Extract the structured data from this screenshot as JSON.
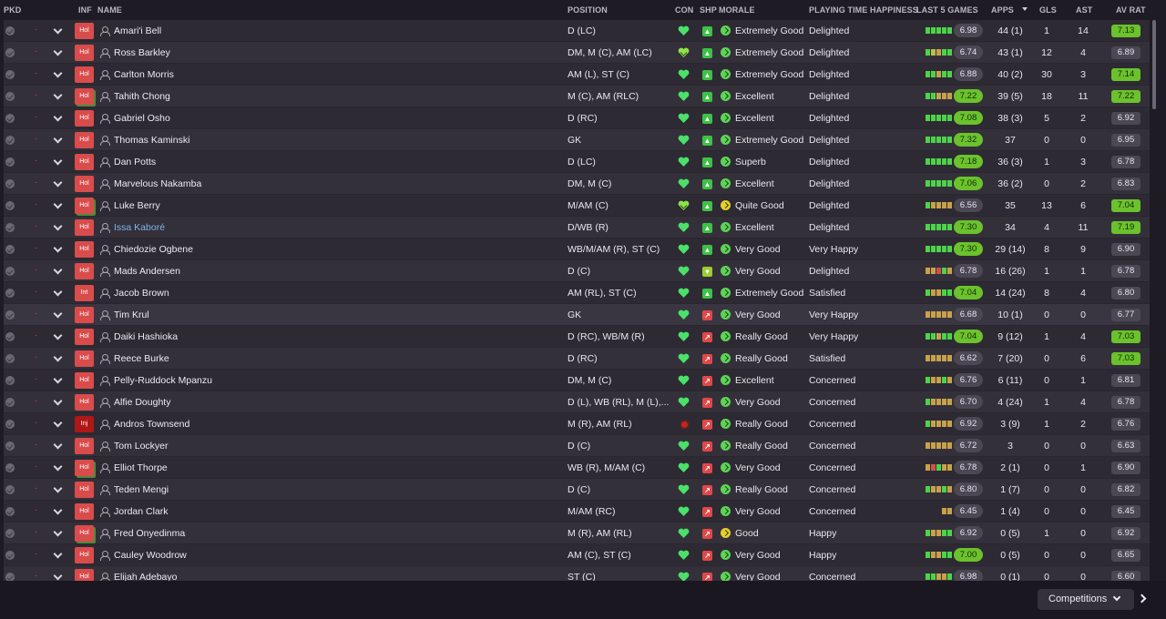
{
  "columns": {
    "pkd": "PKD",
    "inf": "INF",
    "name": "NAME",
    "position": "POSITION",
    "con": "CON",
    "shp": "SHP",
    "morale": "MORALE",
    "pth": "PLAYING TIME HAPPINESS",
    "last5": "LAST 5 GAMES",
    "apps": "APPS",
    "gls": "GLS",
    "ast": "AST",
    "avrat": "AV RAT"
  },
  "colors": {
    "good": "#4dd34a",
    "bad": "#d05151",
    "rating_high": "#6bc22c",
    "injury": "#b01717"
  },
  "players": [
    {
      "inf": "Hol",
      "name": "Amari'i Bell",
      "position": "D (LC)",
      "con": "heart",
      "shp": "g",
      "morale": "Extremely Good",
      "morale_c": "g",
      "pth": "Delighted",
      "form": [
        "g",
        "g",
        "g",
        "g",
        "g"
      ],
      "avg": "6.98",
      "avg_hi": false,
      "apps": "44 (1)",
      "gls": "1",
      "ast": "14",
      "avr": "7.13",
      "avr_hi": true
    },
    {
      "inf": "Hol",
      "name": "Ross Barkley",
      "position": "DM, M (C), AM (LC)",
      "con": "heart-y",
      "shp": "g",
      "morale": "Extremely Good",
      "morale_c": "g",
      "pth": "Delighted",
      "form": [
        "g",
        "y",
        "o",
        "g",
        "g"
      ],
      "avg": "6.74",
      "avg_hi": false,
      "apps": "43 (1)",
      "gls": "12",
      "ast": "4",
      "avr": "6.89",
      "avr_hi": false
    },
    {
      "inf": "Hol",
      "name": "Carlton Morris",
      "position": "AM (L), ST (C)",
      "con": "heart",
      "shp": "g",
      "morale": "Extremely Good",
      "morale_c": "g",
      "pth": "Delighted",
      "form": [
        "g",
        "g",
        "o",
        "g",
        "g"
      ],
      "avg": "6.88",
      "avg_hi": false,
      "apps": "40 (2)",
      "gls": "30",
      "ast": "3",
      "avr": "7.14",
      "avr_hi": true
    },
    {
      "inf": "Hol",
      "name": "Tahith Chong",
      "position": "M (C), AM (RLC)",
      "con": "heart",
      "shp": "g",
      "morale": "Excellent",
      "morale_c": "g",
      "pth": "Delighted",
      "form": [
        "g",
        "g",
        "o",
        "o",
        "o"
      ],
      "avg": "7.22",
      "avg_hi": true,
      "apps": "39 (5)",
      "gls": "18",
      "ast": "11",
      "avr": "7.22",
      "avr_hi": true,
      "grn": true
    },
    {
      "inf": "Hol",
      "name": "Gabriel Osho",
      "position": "D (RC)",
      "con": "heart",
      "shp": "g",
      "morale": "Excellent",
      "morale_c": "g",
      "pth": "Delighted",
      "form": [
        "g",
        "g",
        "g",
        "g",
        "g"
      ],
      "avg": "7.08",
      "avg_hi": true,
      "apps": "38 (3)",
      "gls": "5",
      "ast": "2",
      "avr": "6.92",
      "avr_hi": false
    },
    {
      "inf": "Hol",
      "name": "Thomas Kaminski",
      "position": "GK",
      "con": "heart",
      "shp": "g",
      "morale": "Extremely Good",
      "morale_c": "g",
      "pth": "Delighted",
      "form": [
        "g",
        "g",
        "g",
        "g",
        "g"
      ],
      "avg": "7.32",
      "avg_hi": true,
      "apps": "37",
      "gls": "0",
      "ast": "0",
      "avr": "6.95",
      "avr_hi": false
    },
    {
      "inf": "Hol",
      "name": "Dan Potts",
      "position": "D (LC)",
      "con": "heart",
      "shp": "g",
      "morale": "Superb",
      "morale_c": "g",
      "pth": "Delighted",
      "form": [
        "g",
        "g",
        "g",
        "g",
        "g"
      ],
      "avg": "7.18",
      "avg_hi": true,
      "apps": "36 (3)",
      "gls": "1",
      "ast": "3",
      "avr": "6.78",
      "avr_hi": false
    },
    {
      "inf": "Hol",
      "name": "Marvelous Nakamba",
      "position": "DM, M (C)",
      "con": "heart",
      "shp": "g",
      "morale": "Excellent",
      "morale_c": "g",
      "pth": "Delighted",
      "form": [
        "g",
        "g",
        "g",
        "g",
        "g"
      ],
      "avg": "7.06",
      "avg_hi": true,
      "apps": "36 (2)",
      "gls": "0",
      "ast": "2",
      "avr": "6.83",
      "avr_hi": false
    },
    {
      "inf": "Hol",
      "name": "Luke Berry",
      "position": "M/AM (C)",
      "con": "heart-y",
      "shp": "g",
      "morale": "Quite Good",
      "morale_c": "y",
      "pth": "Delighted",
      "form": [
        "g",
        "o",
        "o",
        "o",
        "o"
      ],
      "avg": "6.56",
      "avg_hi": false,
      "apps": "35",
      "gls": "13",
      "ast": "6",
      "avr": "7.04",
      "avr_hi": true,
      "grn": true
    },
    {
      "inf": "Hol",
      "name": "Issa Kaboré",
      "position": "D/WB (R)",
      "con": "heart",
      "shp": "g",
      "morale": "Excellent",
      "morale_c": "g",
      "pth": "Delighted",
      "form": [
        "g",
        "g",
        "g",
        "g",
        "g"
      ],
      "avg": "7.30",
      "avg_hi": true,
      "apps": "34",
      "gls": "4",
      "ast": "11",
      "avr": "7.19",
      "avr_hi": true,
      "link": true
    },
    {
      "inf": "Hol",
      "name": "Chiedozie Ogbene",
      "position": "WB/M/AM (R), ST (C)",
      "con": "heart",
      "shp": "g",
      "morale": "Very Good",
      "morale_c": "g",
      "pth": "Very Happy",
      "form": [
        "g",
        "g",
        "g",
        "g",
        "g"
      ],
      "avg": "7.30",
      "avg_hi": true,
      "apps": "29 (14)",
      "gls": "8",
      "ast": "9",
      "avr": "6.90",
      "avr_hi": false
    },
    {
      "inf": "Hol",
      "name": "Mads Andersen",
      "position": "D (C)",
      "con": "heart",
      "shp": "y",
      "morale": "Very Good",
      "morale_c": "g",
      "pth": "Delighted",
      "form": [
        "o",
        "o",
        "r",
        "g",
        "o"
      ],
      "avg": "6.78",
      "avg_hi": false,
      "apps": "16 (26)",
      "gls": "1",
      "ast": "1",
      "avr": "6.78",
      "avr_hi": false
    },
    {
      "inf": "Int",
      "name": "Jacob Brown",
      "position": "AM (RL), ST (C)",
      "con": "heart",
      "shp": "g",
      "morale": "Extremely Good",
      "morale_c": "g",
      "pth": "Satisfied",
      "form": [
        "g",
        "o",
        "o",
        "g",
        "g"
      ],
      "avg": "7.04",
      "avg_hi": true,
      "apps": "14 (24)",
      "gls": "8",
      "ast": "4",
      "avr": "6.80",
      "avr_hi": false
    },
    {
      "inf": "Hol",
      "name": "Tim Krul",
      "position": "GK",
      "con": "heart",
      "shp": "r",
      "morale": "Very Good",
      "morale_c": "g",
      "pth": "Very Happy",
      "form": [
        "o",
        "o",
        "o",
        "o",
        "o"
      ],
      "avg": "6.68",
      "avg_hi": false,
      "apps": "10 (1)",
      "gls": "0",
      "ast": "0",
      "avr": "6.77",
      "avr_hi": false
    },
    {
      "inf": "Hol",
      "name": "Daiki Hashioka",
      "position": "D (RC), WB/M (R)",
      "con": "heart",
      "shp": "r",
      "morale": "Really Good",
      "morale_c": "g",
      "pth": "Very Happy",
      "form": [
        "g",
        "g",
        "o",
        "g",
        "g"
      ],
      "avg": "7.04",
      "avg_hi": true,
      "apps": "9 (12)",
      "gls": "1",
      "ast": "4",
      "avr": "7.03",
      "avr_hi": true
    },
    {
      "inf": "Hol",
      "name": "Reece Burke",
      "position": "D (RC)",
      "con": "heart",
      "shp": "r",
      "morale": "Really Good",
      "morale_c": "g",
      "pth": "Satisfied",
      "form": [
        "o",
        "o",
        "o",
        "o",
        "o"
      ],
      "avg": "6.62",
      "avg_hi": false,
      "apps": "7 (20)",
      "gls": "0",
      "ast": "6",
      "avr": "7.03",
      "avr_hi": true
    },
    {
      "inf": "Hol",
      "name": "Pelly-Ruddock Mpanzu",
      "position": "DM, M (C)",
      "con": "heart",
      "shp": "r",
      "morale": "Excellent",
      "morale_c": "g",
      "pth": "Concerned",
      "form": [
        "g",
        "o",
        "o",
        "g",
        "o"
      ],
      "avg": "6.76",
      "avg_hi": false,
      "apps": "6 (11)",
      "gls": "0",
      "ast": "1",
      "avr": "6.81",
      "avr_hi": false
    },
    {
      "inf": "Hol",
      "name": "Alfie Doughty",
      "position": "D (L), WB (RL), M (L),...",
      "con": "heart",
      "shp": "r",
      "morale": "Very Good",
      "morale_c": "g",
      "pth": "Concerned",
      "form": [
        "g",
        "o",
        "o",
        "o",
        "o"
      ],
      "avg": "6.70",
      "avg_hi": false,
      "apps": "4 (24)",
      "gls": "1",
      "ast": "4",
      "avr": "6.78",
      "avr_hi": false
    },
    {
      "inf": "Inj",
      "name": "Andros Townsend",
      "position": "M (R), AM (RL)",
      "con": "injury",
      "shp": "r",
      "morale": "Really Good",
      "morale_c": "g",
      "pth": "Concerned",
      "form": [
        "g",
        "o",
        "o",
        "o",
        "o"
      ],
      "avg": "6.92",
      "avg_hi": false,
      "apps": "3 (9)",
      "gls": "1",
      "ast": "2",
      "avr": "6.76",
      "avr_hi": false
    },
    {
      "inf": "Hol",
      "name": "Tom Lockyer",
      "position": "D (C)",
      "con": "heart",
      "shp": "r",
      "morale": "Really Good",
      "morale_c": "g",
      "pth": "Concerned",
      "form": [
        "o",
        "o",
        "o",
        "o",
        "o"
      ],
      "avg": "6.72",
      "avg_hi": false,
      "apps": "3",
      "gls": "0",
      "ast": "0",
      "avr": "6.63",
      "avr_hi": false
    },
    {
      "inf": "Hol",
      "name": "Elliot Thorpe",
      "position": "WB (R), M/AM (C)",
      "con": "heart",
      "shp": "r",
      "morale": "Very Good",
      "morale_c": "g",
      "pth": "Concerned",
      "form": [
        "o",
        "r",
        "g",
        "o",
        "o"
      ],
      "avg": "6.78",
      "avg_hi": false,
      "apps": "2 (1)",
      "gls": "0",
      "ast": "1",
      "avr": "6.90",
      "avr_hi": false,
      "grn": true
    },
    {
      "inf": "Hol",
      "name": "Teden Mengi",
      "position": "D (C)",
      "con": "heart",
      "shp": "r",
      "morale": "Really Good",
      "morale_c": "g",
      "pth": "Concerned",
      "form": [
        "g",
        "o",
        "o",
        "g",
        "o"
      ],
      "avg": "6.80",
      "avg_hi": false,
      "apps": "1 (7)",
      "gls": "0",
      "ast": "0",
      "avr": "6.82",
      "avr_hi": false
    },
    {
      "inf": "Hol",
      "name": "Jordan Clark",
      "position": "M/AM (RC)",
      "con": "heart",
      "shp": "r",
      "morale": "Very Good",
      "morale_c": "g",
      "pth": "Concerned",
      "form": [
        "o",
        "o"
      ],
      "avg": "6.45",
      "avg_hi": false,
      "apps": "1 (4)",
      "gls": "0",
      "ast": "0",
      "avr": "6.45",
      "avr_hi": false
    },
    {
      "inf": "Hol",
      "name": "Fred Onyedinma",
      "position": "M (R), AM (RL)",
      "con": "heart",
      "shp": "r",
      "morale": "Good",
      "morale_c": "y",
      "pth": "Happy",
      "form": [
        "g",
        "o",
        "o",
        "g",
        "g"
      ],
      "avg": "6.92",
      "avg_hi": false,
      "apps": "0 (5)",
      "gls": "1",
      "ast": "0",
      "avr": "6.92",
      "avr_hi": false,
      "grn": true
    },
    {
      "inf": "Hol",
      "name": "Cauley Woodrow",
      "position": "AM (C), ST (C)",
      "con": "heart",
      "shp": "r",
      "morale": "Very Good",
      "morale_c": "g",
      "pth": "Happy",
      "form": [
        "g",
        "o",
        "o",
        "g",
        "g"
      ],
      "avg": "7.00",
      "avg_hi": true,
      "apps": "0 (5)",
      "gls": "0",
      "ast": "0",
      "avr": "6.65",
      "avr_hi": false
    },
    {
      "inf": "Hol",
      "name": "Elijah Adebayo",
      "position": "ST (C)",
      "con": "heart",
      "shp": "r",
      "morale": "Very Good",
      "morale_c": "g",
      "pth": "Concerned",
      "form": [
        "g",
        "g",
        "o",
        "o",
        "g"
      ],
      "avg": "6.98",
      "avg_hi": false,
      "apps": "0 (1)",
      "gls": "0",
      "ast": "0",
      "avr": "6.60",
      "avr_hi": false
    }
  ],
  "footer": {
    "competitions": "Competitions"
  }
}
